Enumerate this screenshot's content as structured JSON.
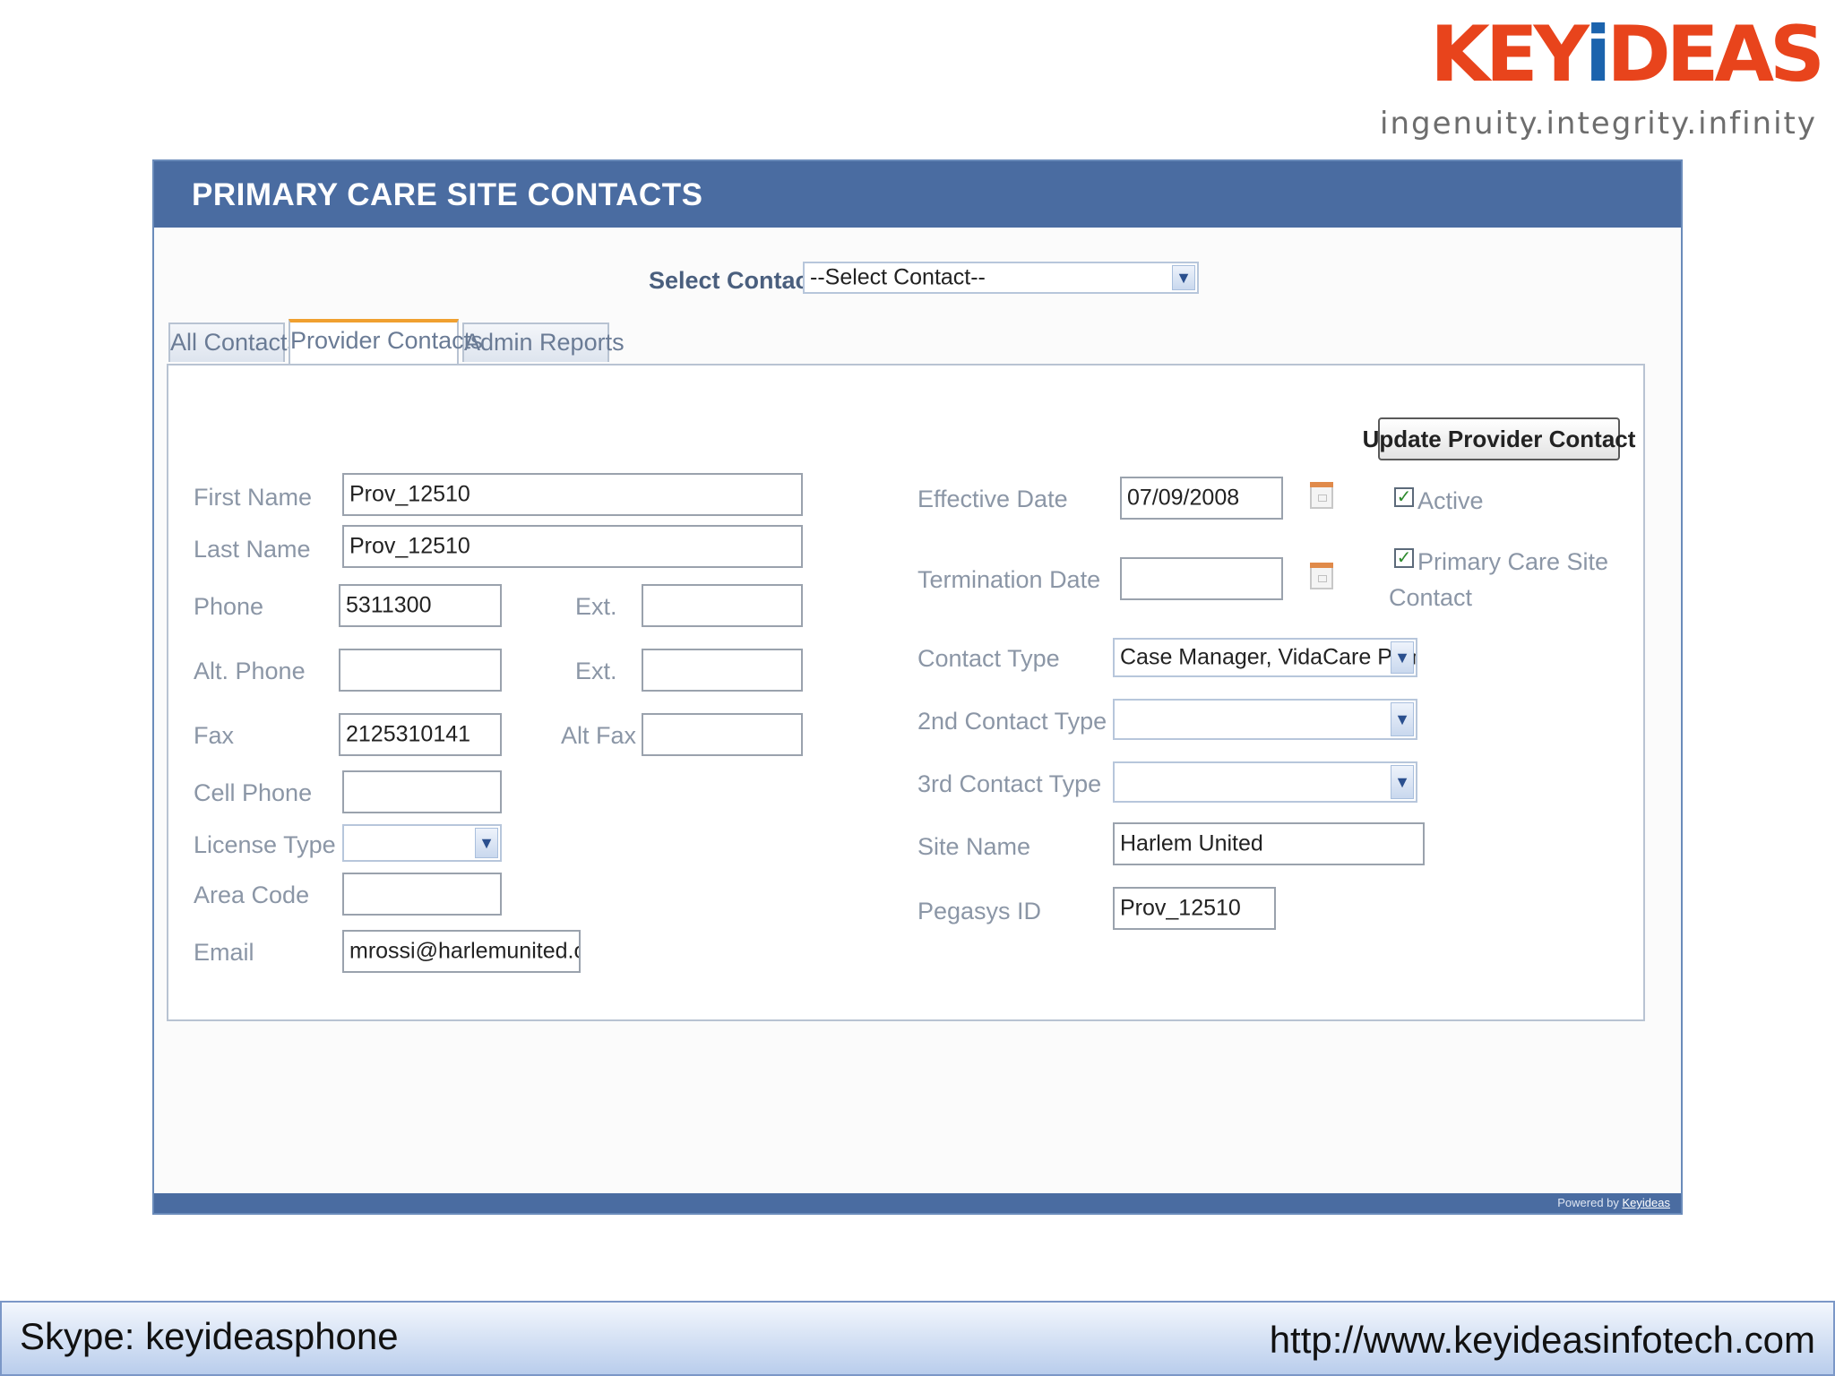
{
  "logo": {
    "part1": "KEY",
    "part2": "i",
    "part3": "DEAS",
    "tagline": "ingenuity.integrity.infinity"
  },
  "window": {
    "title": "PRIMARY CARE SITE CONTACTS",
    "footer_powered_prefix": "Powered by",
    "footer_powered_brand": "Keyideas"
  },
  "select_contact": {
    "label": "Select Contact",
    "value": "--Select Contact--"
  },
  "tabs": [
    {
      "label": "All Contacts"
    },
    {
      "label": "Provider Contacts",
      "active": true
    },
    {
      "label": "Admin Reports"
    }
  ],
  "buttons": {
    "update": "Update Provider Contact"
  },
  "left_fields": {
    "first_name": {
      "label": "First Name",
      "value": "Prov_12510"
    },
    "last_name": {
      "label": "Last Name",
      "value": "Prov_12510"
    },
    "phone": {
      "label": "Phone",
      "value": "5311300"
    },
    "phone_ext": {
      "label": "Ext.",
      "value": ""
    },
    "alt_phone": {
      "label": "Alt. Phone",
      "value": ""
    },
    "alt_phone_ext": {
      "label": "Ext.",
      "value": ""
    },
    "fax": {
      "label": "Fax",
      "value": "2125310141"
    },
    "alt_fax": {
      "label": "Alt Fax",
      "value": ""
    },
    "cell_phone": {
      "label": "Cell Phone",
      "value": ""
    },
    "license_type": {
      "label": "License Type",
      "value": ""
    },
    "area_code": {
      "label": "Area Code",
      "value": ""
    },
    "email": {
      "label": "Email",
      "value": "mrossi@harlemunited.org"
    }
  },
  "right_fields": {
    "effective_date": {
      "label": "Effective Date",
      "value": "07/09/2008"
    },
    "termination_date": {
      "label": "Termination Date",
      "value": ""
    },
    "active": {
      "label": "Active",
      "checked": true
    },
    "primary_care_site_contact": {
      "label_line1": "Primary Care Site",
      "label_line2": "Contact",
      "checked": true
    },
    "contact_type": {
      "label": "Contact Type",
      "value": "Case Manager, VidaCare Primary"
    },
    "contact_type_2": {
      "label": "2nd Contact Type",
      "value": ""
    },
    "contact_type_3": {
      "label": "3rd Contact Type",
      "value": ""
    },
    "site_name": {
      "label": "Site Name",
      "value": "Harlem United"
    },
    "pegasys_id": {
      "label": "Pegasys ID",
      "value": "Prov_12510"
    }
  },
  "bottom_bar": {
    "skype": "Skype: keyideasphone",
    "url": "http://www.keyideasinfotech.com"
  },
  "colors": {
    "header_blue": "#4a6ca1",
    "logo_orange": "#e8441c",
    "logo_blue": "#1b63ad",
    "tab_active_accent": "#f0a030",
    "checkbox_green": "#2d8a2d"
  },
  "icons": {
    "dropdown": "chevron-down-icon",
    "calendar": "calendar-icon",
    "checkbox": "checkmark-icon"
  }
}
